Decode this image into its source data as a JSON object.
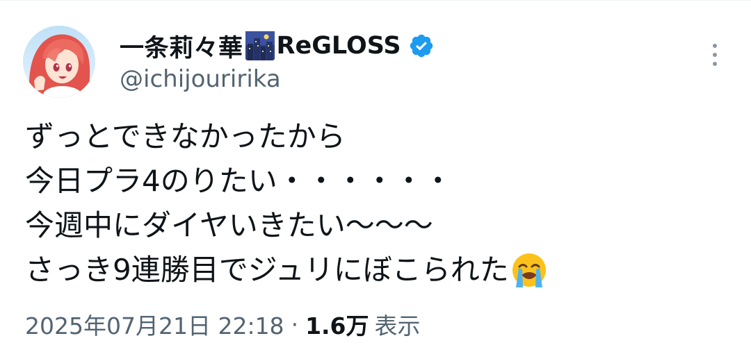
{
  "author": {
    "display_name": "一条莉々華",
    "name_suffix": "ReGLOSS",
    "name_emoji": "night-city-emoji",
    "verified": true,
    "verified_color": "#1d9bf0",
    "handle": "@ichijouririka",
    "avatar": "avatar-anime-girl-red-hair"
  },
  "tweet": {
    "lines": [
      "ずっとできなかったから",
      "今日プラ4のりたい・・・・・・",
      "今週中にダイヤいきたい〜〜〜",
      "さっき9連勝目でジュリにぼこられた"
    ],
    "trailing_emoji": "loudly-crying-face-emoji"
  },
  "meta": {
    "timestamp": "2025年07月21日 22:18",
    "separator": "·",
    "views_count": "1.6万",
    "views_label": "表示"
  },
  "menu": {
    "icon": "more-vertical-icon"
  },
  "colors": {
    "text_primary": "#0f1419",
    "text_secondary": "#536471",
    "accent": "#1d9bf0"
  }
}
